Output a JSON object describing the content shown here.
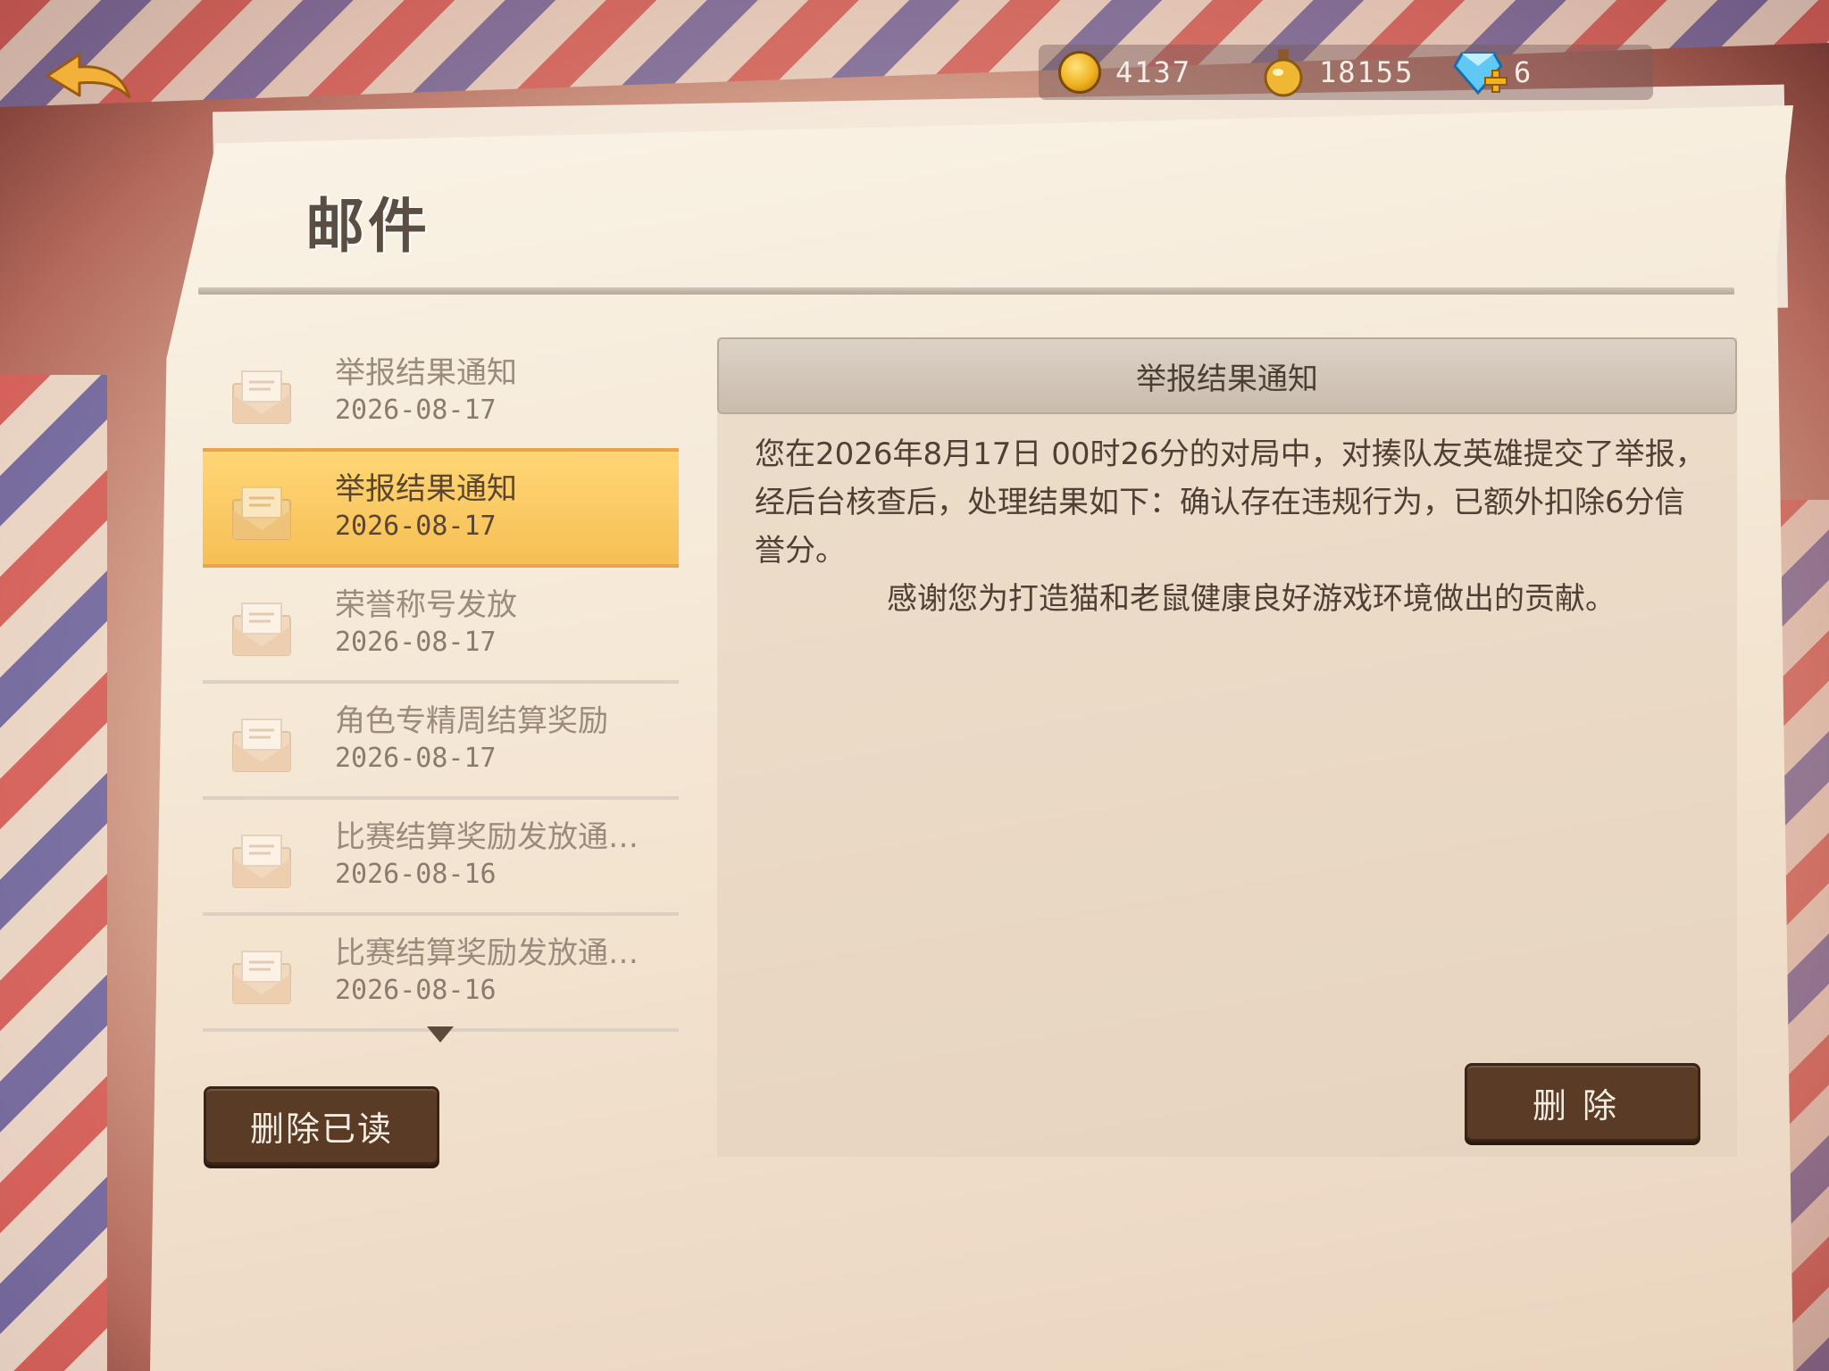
{
  "currency": {
    "gold": "4137",
    "potion": "18155",
    "diamond": "6"
  },
  "page": {
    "title": "邮件"
  },
  "mail_list": [
    {
      "subject": "举报结果通知",
      "date": "2026-08-17",
      "selected": false
    },
    {
      "subject": "举报结果通知",
      "date": "2026-08-17",
      "selected": true
    },
    {
      "subject": "荣誉称号发放",
      "date": "2026-08-17",
      "selected": false
    },
    {
      "subject": "角色专精周结算奖励",
      "date": "2026-08-17",
      "selected": false
    },
    {
      "subject": "比赛结算奖励发放通…",
      "date": "2026-08-16",
      "selected": false
    },
    {
      "subject": "比赛结算奖励发放通…",
      "date": "2026-08-16",
      "selected": false
    }
  ],
  "buttons": {
    "delete_read": "删除已读",
    "delete": "删除"
  },
  "detail": {
    "title": "举报结果通知",
    "paragraph1": "您在2026年8月17日 00时26分的对局中，对揍队友英雄提交了举报，经后台核查后，处理结果如下：确认存在违规行为，已额外扣除6分信誉分。",
    "paragraph2": "感谢您为打造猫和老鼠健康良好游戏环境做出的贡献。"
  },
  "icons": {
    "back": "back-arrow-icon",
    "gold": "gold-coin-icon",
    "potion": "potion-icon",
    "diamond": "diamond-icon",
    "mail": "envelope-icon",
    "scroll": "triangle-down-icon"
  }
}
